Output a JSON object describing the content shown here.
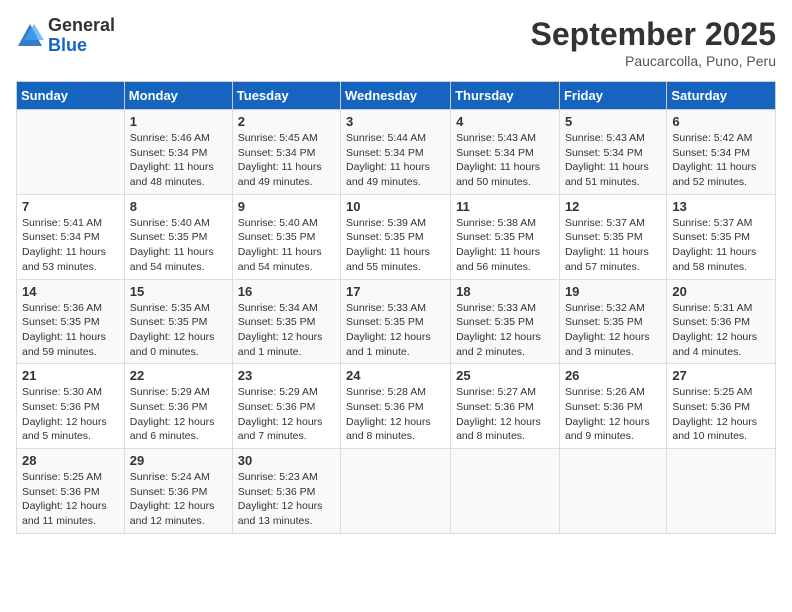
{
  "logo": {
    "general": "General",
    "blue": "Blue"
  },
  "title": "September 2025",
  "subtitle": "Paucarcolla, Puno, Peru",
  "days_of_week": [
    "Sunday",
    "Monday",
    "Tuesday",
    "Wednesday",
    "Thursday",
    "Friday",
    "Saturday"
  ],
  "weeks": [
    [
      {
        "day": "",
        "info": ""
      },
      {
        "day": "1",
        "info": "Sunrise: 5:46 AM\nSunset: 5:34 PM\nDaylight: 11 hours and 48 minutes."
      },
      {
        "day": "2",
        "info": "Sunrise: 5:45 AM\nSunset: 5:34 PM\nDaylight: 11 hours and 49 minutes."
      },
      {
        "day": "3",
        "info": "Sunrise: 5:44 AM\nSunset: 5:34 PM\nDaylight: 11 hours and 49 minutes."
      },
      {
        "day": "4",
        "info": "Sunrise: 5:43 AM\nSunset: 5:34 PM\nDaylight: 11 hours and 50 minutes."
      },
      {
        "day": "5",
        "info": "Sunrise: 5:43 AM\nSunset: 5:34 PM\nDaylight: 11 hours and 51 minutes."
      },
      {
        "day": "6",
        "info": "Sunrise: 5:42 AM\nSunset: 5:34 PM\nDaylight: 11 hours and 52 minutes."
      }
    ],
    [
      {
        "day": "7",
        "info": "Sunrise: 5:41 AM\nSunset: 5:34 PM\nDaylight: 11 hours and 53 minutes."
      },
      {
        "day": "8",
        "info": "Sunrise: 5:40 AM\nSunset: 5:35 PM\nDaylight: 11 hours and 54 minutes."
      },
      {
        "day": "9",
        "info": "Sunrise: 5:40 AM\nSunset: 5:35 PM\nDaylight: 11 hours and 54 minutes."
      },
      {
        "day": "10",
        "info": "Sunrise: 5:39 AM\nSunset: 5:35 PM\nDaylight: 11 hours and 55 minutes."
      },
      {
        "day": "11",
        "info": "Sunrise: 5:38 AM\nSunset: 5:35 PM\nDaylight: 11 hours and 56 minutes."
      },
      {
        "day": "12",
        "info": "Sunrise: 5:37 AM\nSunset: 5:35 PM\nDaylight: 11 hours and 57 minutes."
      },
      {
        "day": "13",
        "info": "Sunrise: 5:37 AM\nSunset: 5:35 PM\nDaylight: 11 hours and 58 minutes."
      }
    ],
    [
      {
        "day": "14",
        "info": "Sunrise: 5:36 AM\nSunset: 5:35 PM\nDaylight: 11 hours and 59 minutes."
      },
      {
        "day": "15",
        "info": "Sunrise: 5:35 AM\nSunset: 5:35 PM\nDaylight: 12 hours and 0 minutes."
      },
      {
        "day": "16",
        "info": "Sunrise: 5:34 AM\nSunset: 5:35 PM\nDaylight: 12 hours and 1 minute."
      },
      {
        "day": "17",
        "info": "Sunrise: 5:33 AM\nSunset: 5:35 PM\nDaylight: 12 hours and 1 minute."
      },
      {
        "day": "18",
        "info": "Sunrise: 5:33 AM\nSunset: 5:35 PM\nDaylight: 12 hours and 2 minutes."
      },
      {
        "day": "19",
        "info": "Sunrise: 5:32 AM\nSunset: 5:35 PM\nDaylight: 12 hours and 3 minutes."
      },
      {
        "day": "20",
        "info": "Sunrise: 5:31 AM\nSunset: 5:36 PM\nDaylight: 12 hours and 4 minutes."
      }
    ],
    [
      {
        "day": "21",
        "info": "Sunrise: 5:30 AM\nSunset: 5:36 PM\nDaylight: 12 hours and 5 minutes."
      },
      {
        "day": "22",
        "info": "Sunrise: 5:29 AM\nSunset: 5:36 PM\nDaylight: 12 hours and 6 minutes."
      },
      {
        "day": "23",
        "info": "Sunrise: 5:29 AM\nSunset: 5:36 PM\nDaylight: 12 hours and 7 minutes."
      },
      {
        "day": "24",
        "info": "Sunrise: 5:28 AM\nSunset: 5:36 PM\nDaylight: 12 hours and 8 minutes."
      },
      {
        "day": "25",
        "info": "Sunrise: 5:27 AM\nSunset: 5:36 PM\nDaylight: 12 hours and 8 minutes."
      },
      {
        "day": "26",
        "info": "Sunrise: 5:26 AM\nSunset: 5:36 PM\nDaylight: 12 hours and 9 minutes."
      },
      {
        "day": "27",
        "info": "Sunrise: 5:25 AM\nSunset: 5:36 PM\nDaylight: 12 hours and 10 minutes."
      }
    ],
    [
      {
        "day": "28",
        "info": "Sunrise: 5:25 AM\nSunset: 5:36 PM\nDaylight: 12 hours and 11 minutes."
      },
      {
        "day": "29",
        "info": "Sunrise: 5:24 AM\nSunset: 5:36 PM\nDaylight: 12 hours and 12 minutes."
      },
      {
        "day": "30",
        "info": "Sunrise: 5:23 AM\nSunset: 5:36 PM\nDaylight: 12 hours and 13 minutes."
      },
      {
        "day": "",
        "info": ""
      },
      {
        "day": "",
        "info": ""
      },
      {
        "day": "",
        "info": ""
      },
      {
        "day": "",
        "info": ""
      }
    ]
  ]
}
